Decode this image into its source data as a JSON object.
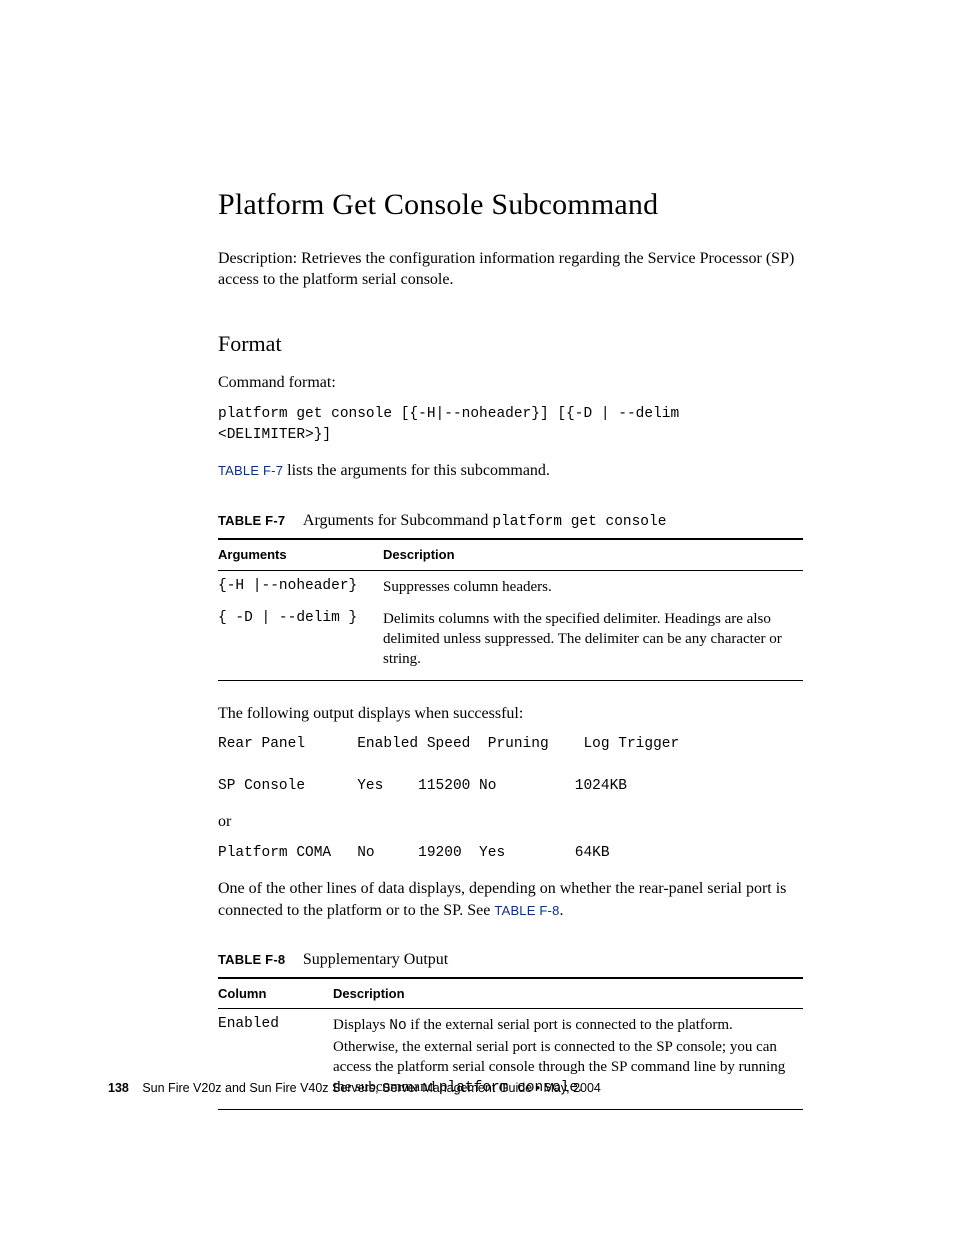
{
  "heading": "Platform Get Console Subcommand",
  "desc": "Description: Retrieves the configuration information regarding the Service Processor (SP) access to the platform serial console.",
  "format_hd": "Format",
  "cmd_fmt_label": "Command format:",
  "cmd_fmt_code": "platform get console [{-H|--noheader}] [{-D | --delim\n<DELIMITER>}]",
  "ref_f7_pre": "",
  "ref_f7": "TABLE F-7",
  "ref_f7_post": " lists the arguments for this subcommand.",
  "table_f7": {
    "label": "TABLE F-7",
    "caption": "Arguments for Subcommand ",
    "caption_mono": "platform get console",
    "head_arg": "Arguments",
    "head_desc": "Description",
    "rows": [
      {
        "arg": "{-H |--noheader}",
        "desc": "Suppresses column headers."
      },
      {
        "arg": "{ -D | --delim }",
        "desc": "Delimits columns with the specified delimiter. Headings are also delimited unless suppressed. The delimiter can be any character or string."
      }
    ]
  },
  "out_intro": "The following output displays when successful:",
  "output_block1": "Rear Panel      Enabled Speed  Pruning    Log Trigger\n\nSP Console      Yes    115200 No         1024KB",
  "or_txt": "or",
  "output_block2": "Platform COMA   No     19200  Yes        64KB",
  "after_out_1": "One of the other lines of data displays, depending on whether the rear-panel serial port is connected to the platform or to the SP. See ",
  "ref_f8": "TABLE F-8",
  "after_out_2": ".",
  "table_f8": {
    "label": "TABLE F-8",
    "caption": "Supplementary Output",
    "head_col": "Column",
    "head_desc": "Description",
    "rows": [
      {
        "col": "Enabled",
        "desc_1": "Displays ",
        "desc_mono1": "No",
        "desc_2": " if the external serial port is connected to the platform. Otherwise, the external serial port is connected to the SP console; you can access the platform serial console through the SP command line by running the subcommand ",
        "desc_mono2": "platform console",
        "desc_3": "."
      }
    ]
  },
  "footer": {
    "page": "138",
    "text": "Sun Fire V20z and Sun Fire V40z Servers, Server Management Guide • May, 2004"
  }
}
